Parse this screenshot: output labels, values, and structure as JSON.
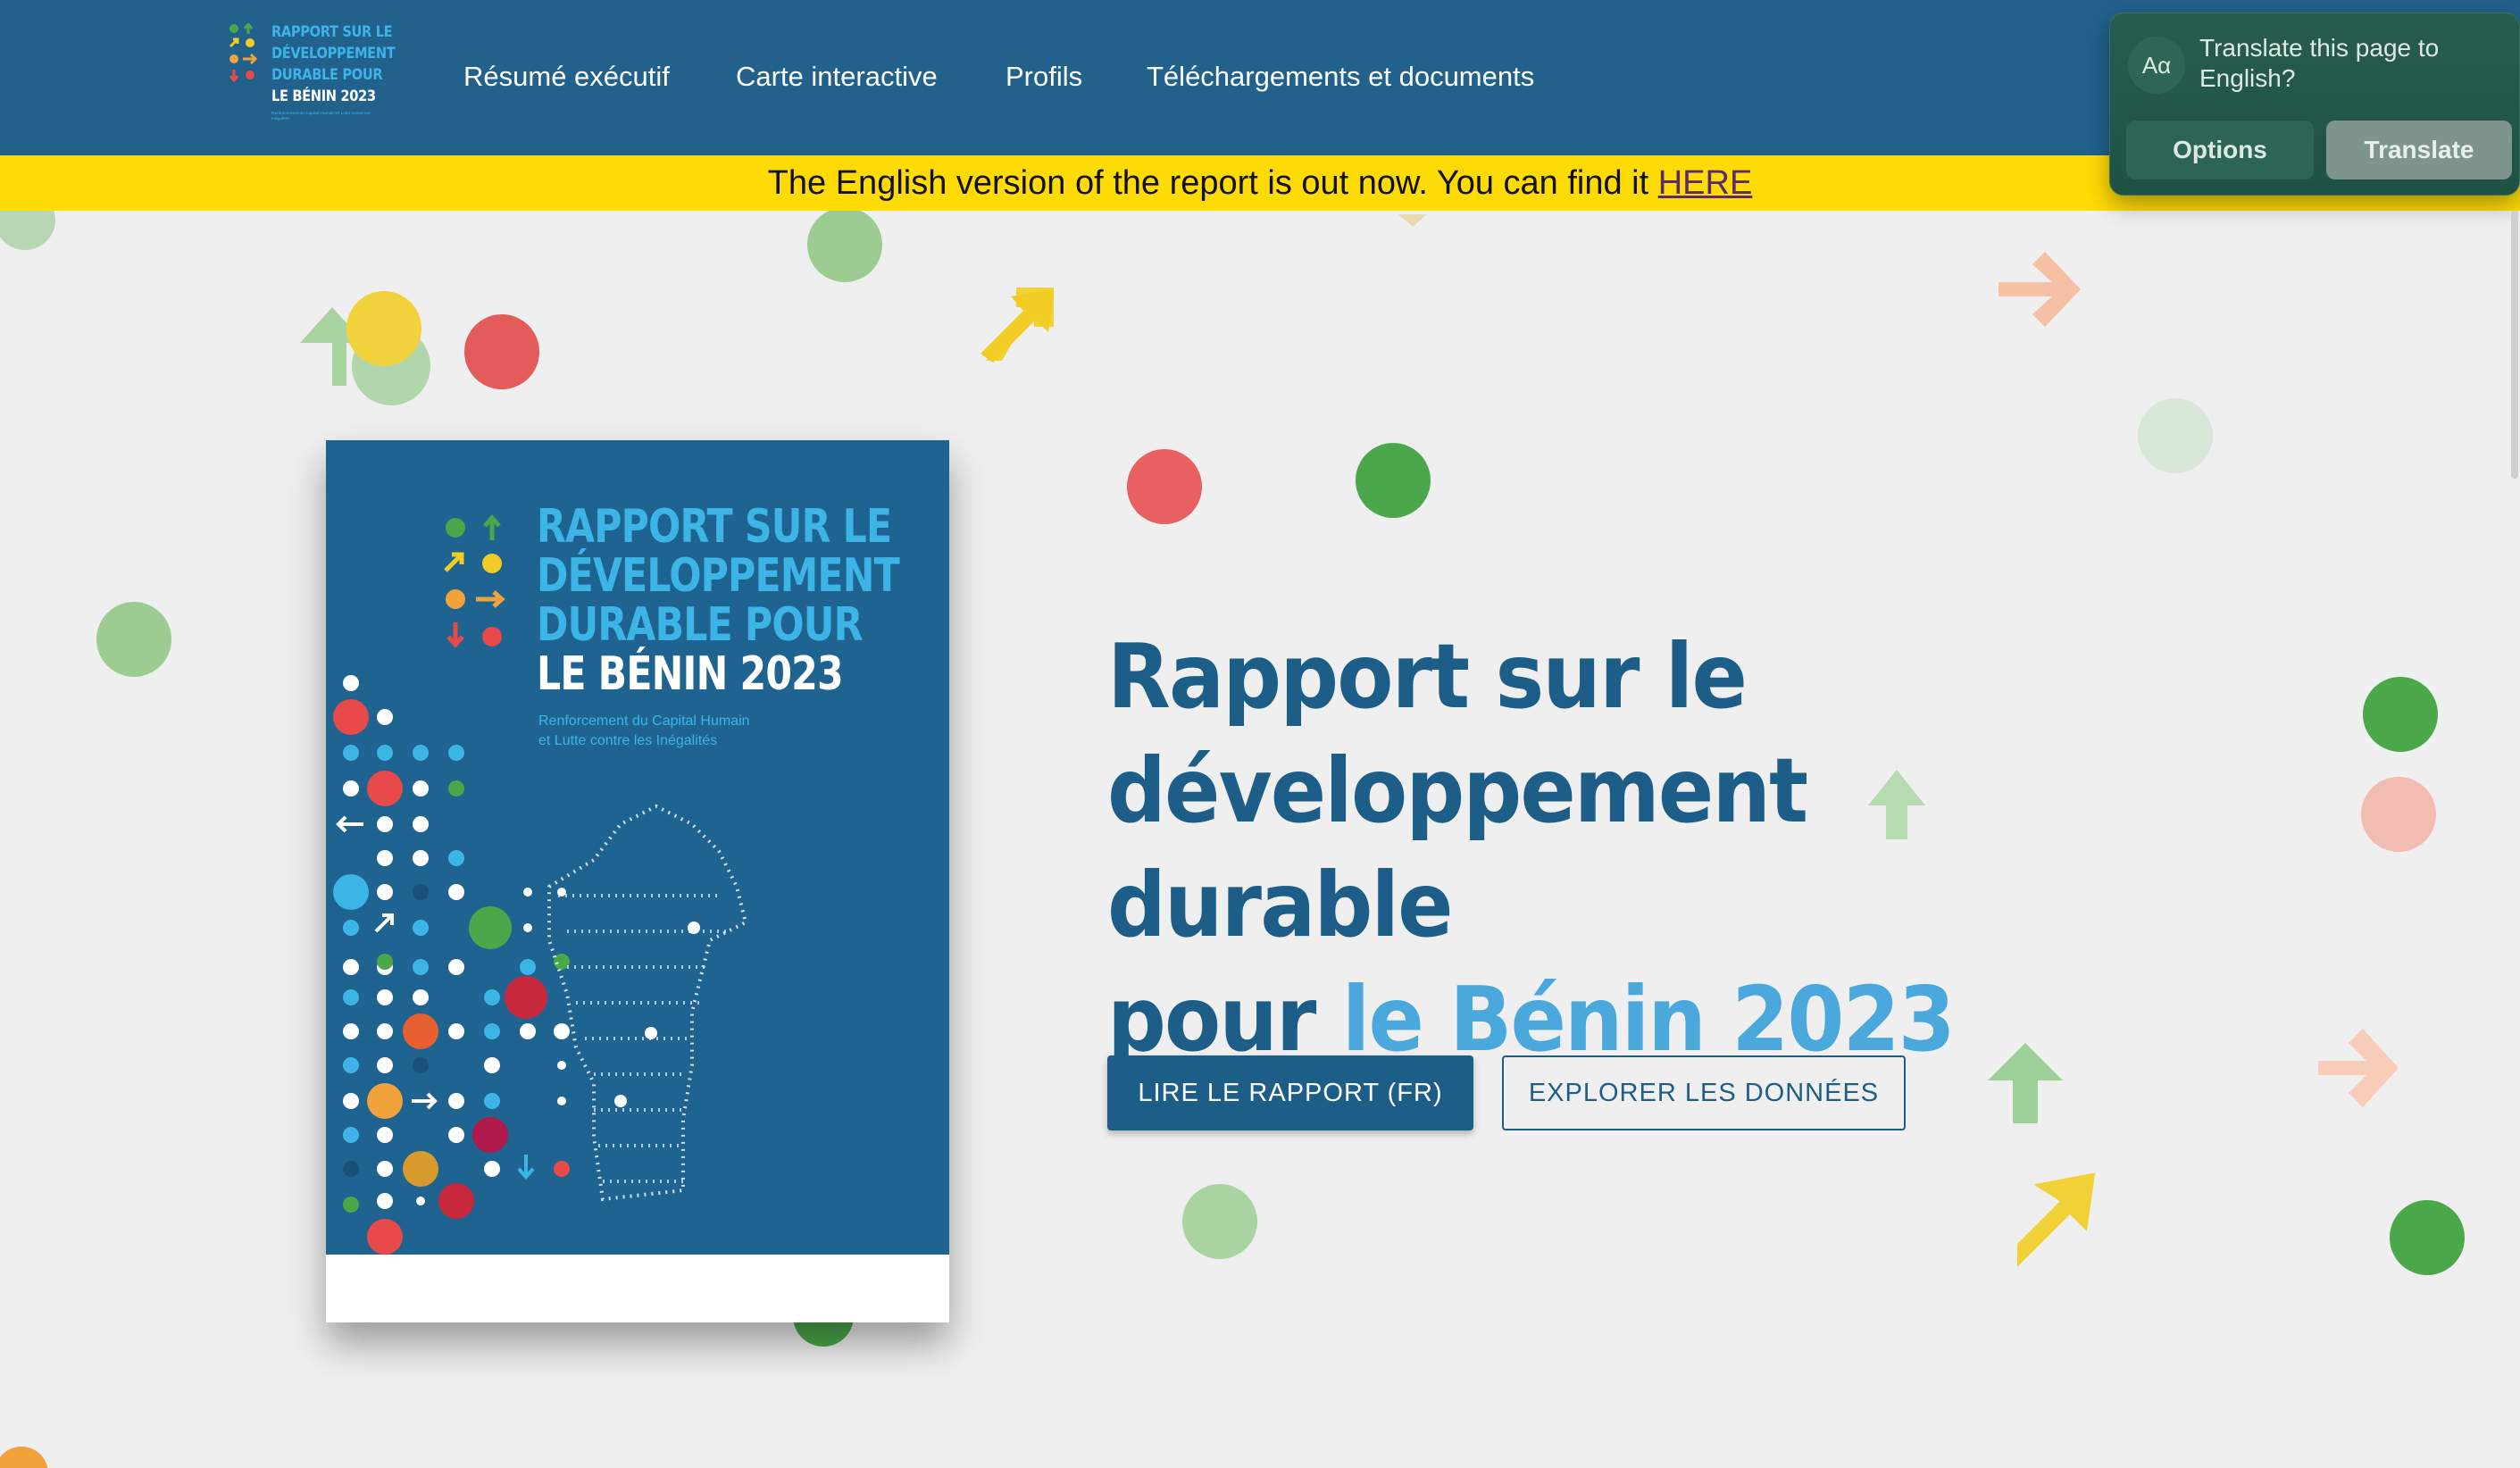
{
  "header": {
    "logo": {
      "line1": "RAPPORT SUR LE",
      "line2": "DÉVELOPPEMENT",
      "line3": "DURABLE POUR",
      "line4": "LE BÉNIN 2023",
      "subtitle": "Renforcement du Capital Humain et Lutte contre les Inégalités"
    },
    "nav": [
      {
        "label": "Résumé exécutif"
      },
      {
        "label": "Carte interactive"
      },
      {
        "label": "Profils"
      },
      {
        "label": "Téléchargements et documents"
      }
    ]
  },
  "banner": {
    "text": "The English version of the report is out now. You can find it ",
    "link": "HERE"
  },
  "cover": {
    "line1": "RAPPORT SUR LE",
    "line2": "DÉVELOPPEMENT",
    "line3": "DURABLE POUR",
    "line4": "LE BÉNIN 2023",
    "subtitle_line1": "Renforcement du Capital Humain",
    "subtitle_line2": "et Lutte contre les Inégalités"
  },
  "hero": {
    "title_line1": "Rapport sur le",
    "title_line2": "développement durable",
    "title_line3_plain": "pour ",
    "title_line3_accent": "le Bénin 2023"
  },
  "buttons": {
    "primary": "LIRE LE RAPPORT (FR)",
    "secondary": "EXPLORER LES DONNÉES"
  },
  "translate_popup": {
    "icon": "Aα",
    "message": "Translate this page to English?",
    "options_label": "Options",
    "translate_label": "Translate"
  },
  "colors": {
    "header": "#21618c",
    "banner": "#fedb05",
    "hero_title": "#1d5e89",
    "hero_accent": "#4aa8dd",
    "page_bg": "#efefef"
  }
}
